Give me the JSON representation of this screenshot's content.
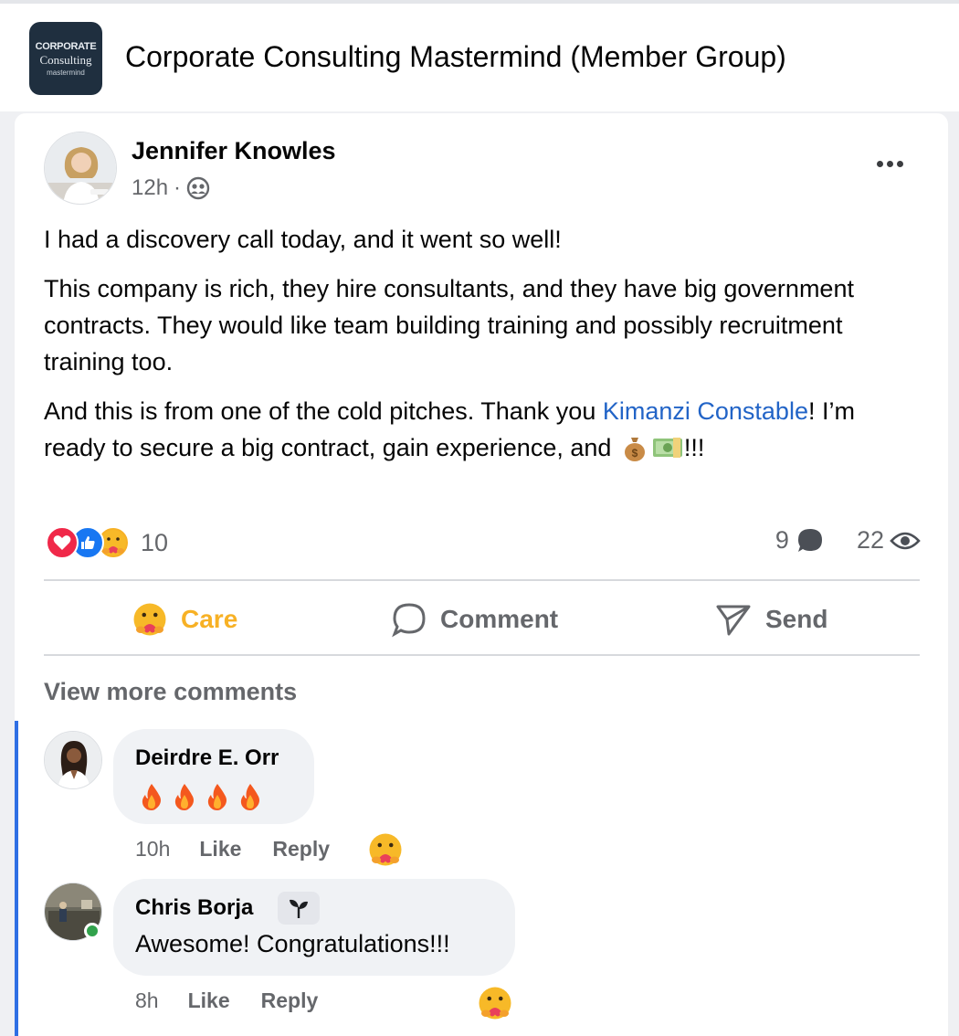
{
  "group": {
    "title": "Corporate Consulting Mastermind (Member Group)",
    "logo_text": [
      "CORPORATE",
      "Consulting",
      "mastermind"
    ]
  },
  "post": {
    "author": "Jennifer Knowles",
    "time": "12h",
    "time_separator": "·",
    "privacy_icon": "group-icon",
    "paragraphs": {
      "p1": "I had a discovery call today, and it went so well!",
      "p2": "This company is rich, they hire consultants, and they have big government contracts. They would like team building training and possibly recruitment training too.",
      "p3_before": "And this is from one of the cold pitches. Thank you ",
      "p3_mention": "Kimanzi Constable",
      "p3_after": "! I’m ready to secure a big contract, gain experience, and ",
      "p3_end": "!!!",
      "p3_emoji": [
        "money-bag-icon",
        "dollar-bills-icon"
      ]
    },
    "reactions": {
      "types": [
        "love-reaction-icon",
        "like-reaction-icon",
        "care-reaction-icon"
      ],
      "count": "10"
    },
    "comments_count": "9",
    "views_count": "22"
  },
  "actions": {
    "care": "Care",
    "comment": "Comment",
    "send": "Send"
  },
  "comments": {
    "view_more": "View more comments",
    "items": [
      {
        "author": "Deirdre E. Orr",
        "text_emoji": [
          "fire-icon",
          "fire-icon",
          "fire-icon",
          "fire-icon"
        ],
        "time": "10h",
        "like": "Like",
        "reply": "Reply",
        "reaction": "care-reaction-icon"
      },
      {
        "author": "Chris Borja",
        "badge_icon": "seedling-icon",
        "text": "Awesome! Congratulations!!!",
        "time": "8h",
        "like": "Like",
        "reply": "Reply",
        "reaction": "care-reaction-icon",
        "online": true
      }
    ]
  },
  "colors": {
    "accent_link": "#2264c7",
    "care_yellow": "#f7b125",
    "secondary_text": "#65676b",
    "thread_bar": "#2f6fe4",
    "online_green": "#31a24c"
  }
}
